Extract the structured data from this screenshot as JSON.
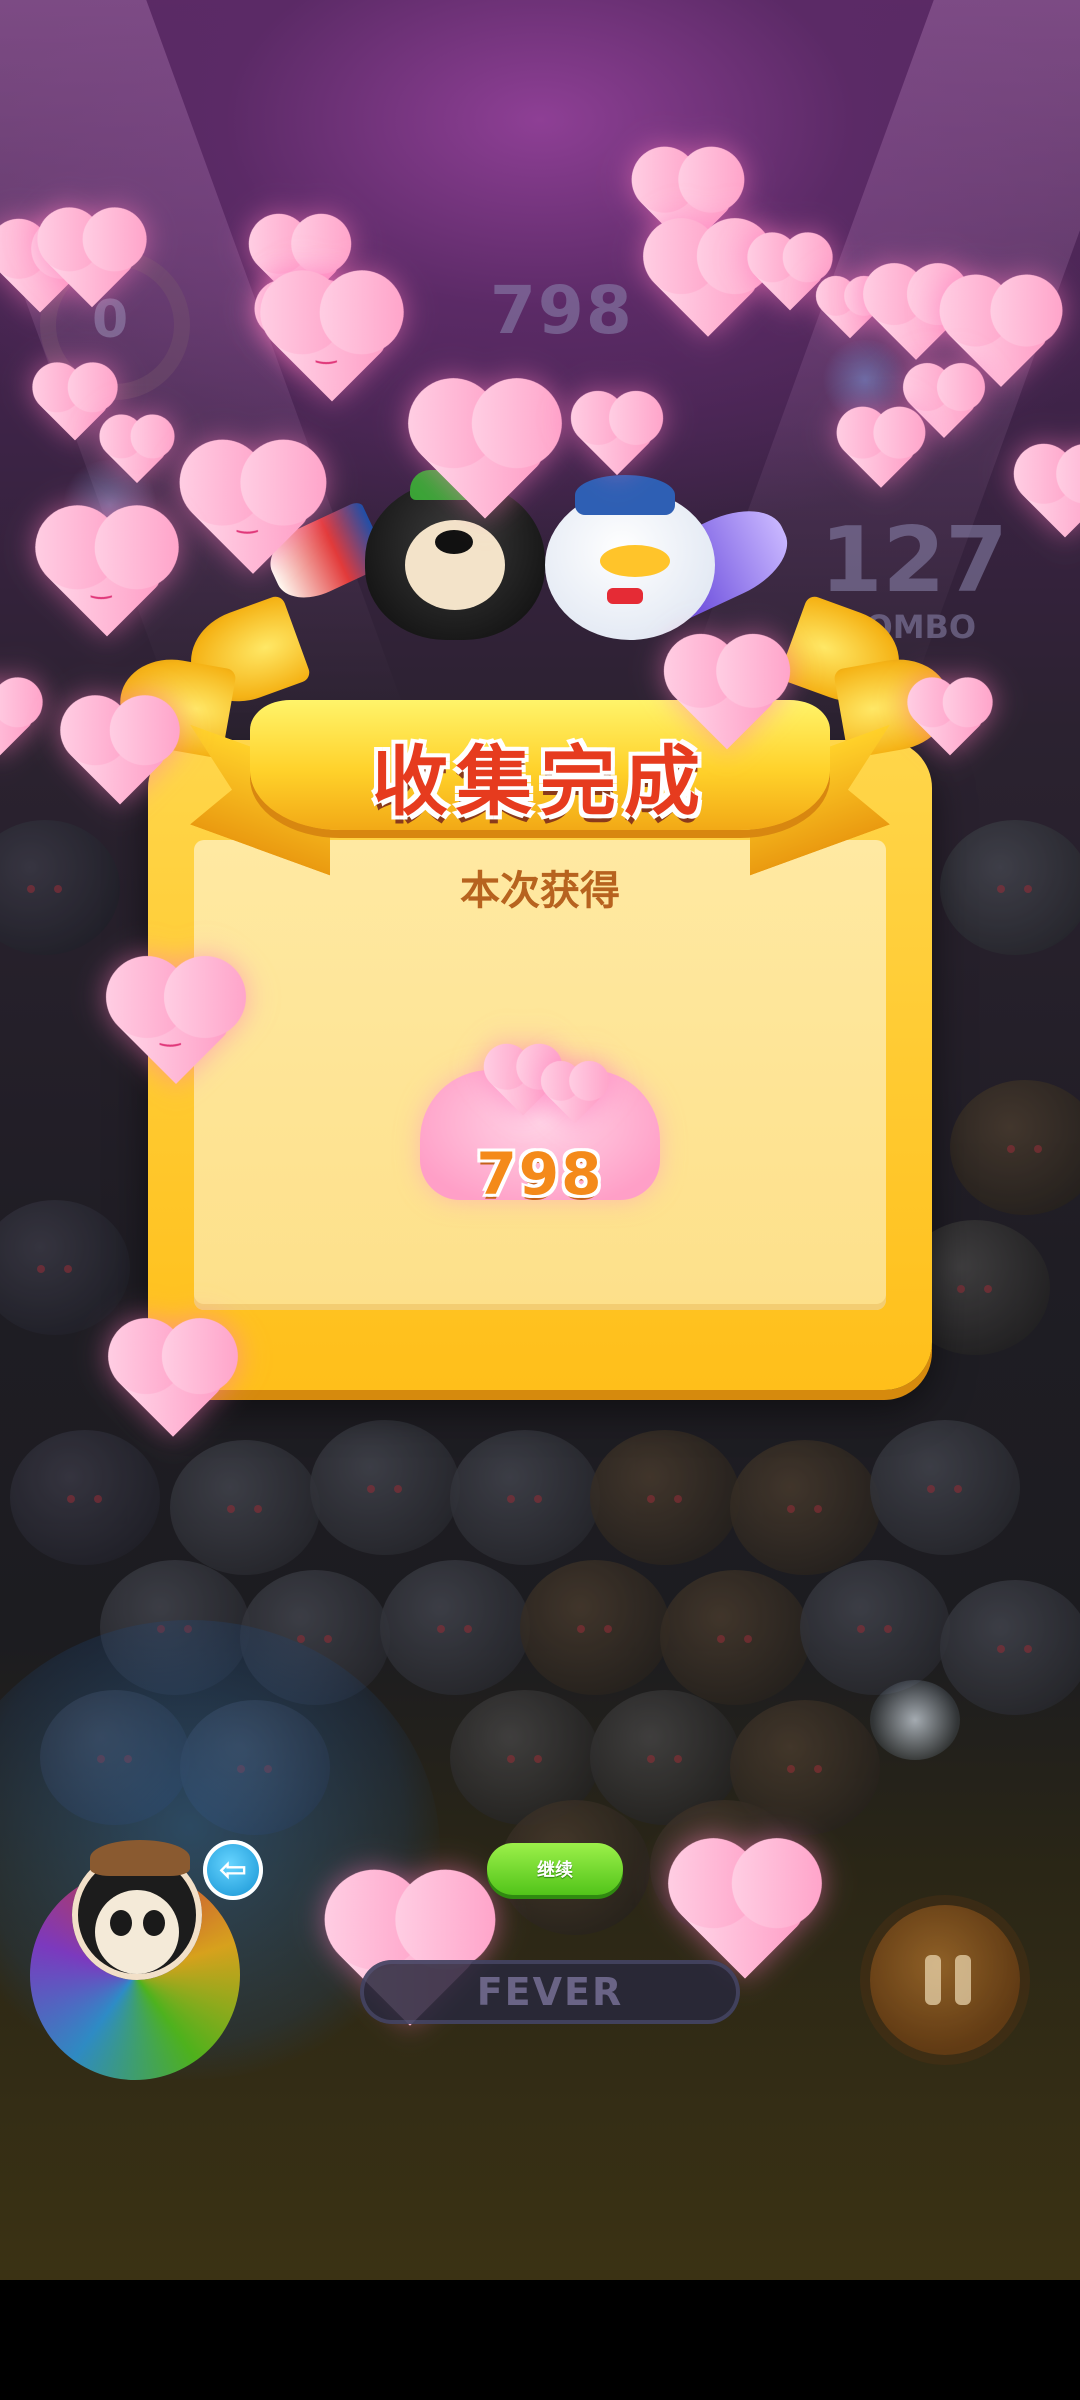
{
  "dialog": {
    "title": "收集完成",
    "subtitle": "本次获得",
    "reward_amount": "798",
    "reward_icon": "heart-pile-icon"
  },
  "hud": {
    "score": "798",
    "combo_count": "127",
    "combo_label": "COMBO",
    "ring_value": "0",
    "fever_label": "FEVER",
    "continue_label": "继续",
    "back_icon": "arrow-left",
    "pause_icon": "pause"
  },
  "colors": {
    "panel": "#ffc629",
    "title_text": "#e63b1e",
    "subtitle_text": "#b7631f",
    "continue_button": "#6fd11f",
    "heart": "#ff9cc5"
  }
}
